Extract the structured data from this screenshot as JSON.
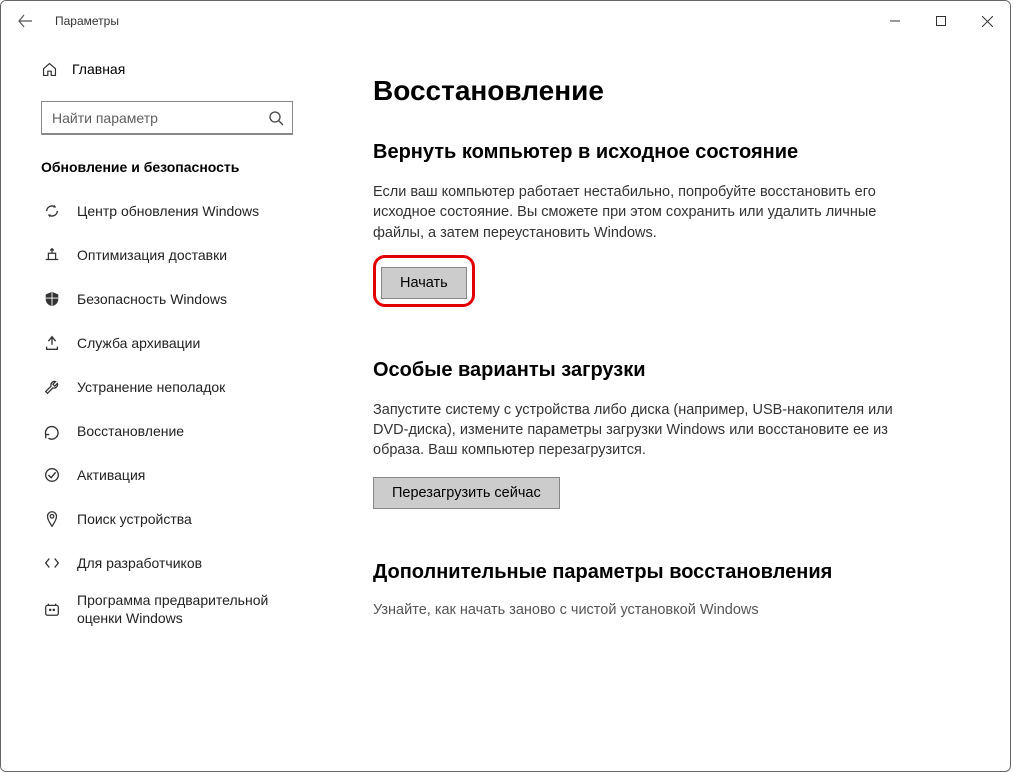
{
  "window": {
    "title": "Параметры",
    "home_label": "Главная",
    "search_placeholder": "Найти параметр",
    "group_heading": "Обновление и безопасность"
  },
  "sidebar": {
    "items": [
      {
        "label": "Центр обновления Windows"
      },
      {
        "label": "Оптимизация доставки"
      },
      {
        "label": "Безопасность Windows"
      },
      {
        "label": "Служба архивации"
      },
      {
        "label": "Устранение неполадок"
      },
      {
        "label": "Восстановление"
      },
      {
        "label": "Активация"
      },
      {
        "label": "Поиск устройства"
      },
      {
        "label": "Для разработчиков"
      },
      {
        "label": "Программа предварительной оценки Windows"
      }
    ]
  },
  "main": {
    "page_title": "Восстановление",
    "section1": {
      "heading": "Вернуть компьютер в исходное состояние",
      "desc": "Если ваш компьютер работает нестабильно, попробуйте восстановить его исходное состояние. Вы сможете при этом сохранить или удалить личные файлы, а затем переустановить Windows.",
      "button": "Начать"
    },
    "section2": {
      "heading": "Особые варианты загрузки",
      "desc": "Запустите систему с устройства либо диска (например, USB-накопителя или DVD-диска), измените параметры загрузки Windows или восстановите ее из образа. Ваш компьютер перезагрузится.",
      "button": "Перезагрузить сейчас"
    },
    "section3": {
      "heading": "Дополнительные параметры восстановления",
      "link": "Узнайте, как начать заново с чистой установкой Windows"
    }
  }
}
